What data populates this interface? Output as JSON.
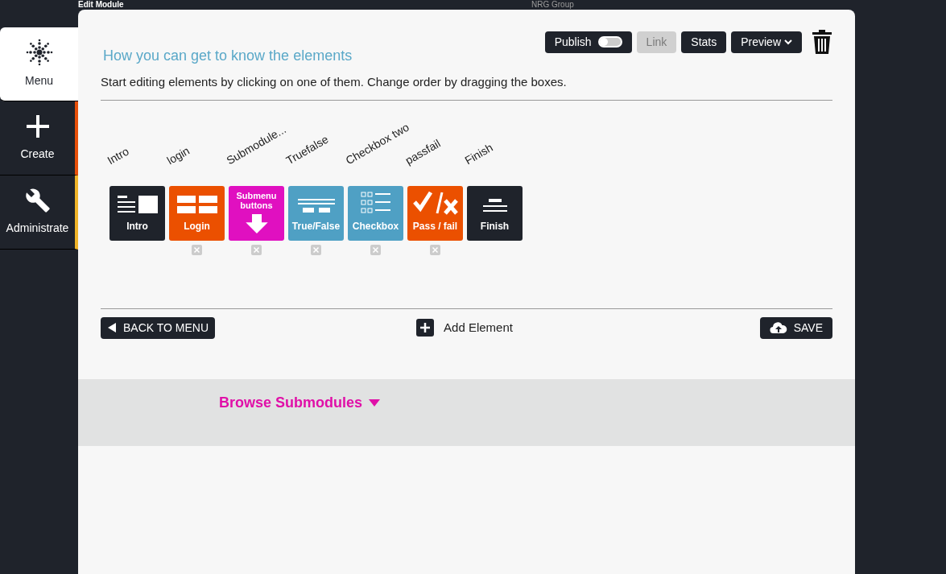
{
  "header": {
    "title": "Edit Module",
    "group": "NRG Group"
  },
  "sidebar": {
    "items": [
      {
        "label": "Menu",
        "kind": "menu",
        "selected": true,
        "color": "#ffffff"
      },
      {
        "label": "Create",
        "kind": "create",
        "selected": false,
        "color": "#e8500a"
      },
      {
        "label": "Administrate",
        "kind": "admin",
        "selected": false,
        "color": "#f0b428"
      }
    ]
  },
  "toolbar": {
    "publish": {
      "label": "Publish",
      "on": false
    },
    "link": {
      "label": "Link",
      "disabled": true
    },
    "stats": "Stats",
    "preview": "Preview"
  },
  "heading": "How you can get to know the elements",
  "instructions": "Start editing elements by clicking on one of them. Change order by dragging the boxes.",
  "elements": [
    {
      "name": "Intro",
      "title": "Intro",
      "kind": "intro",
      "color": "#1f232b",
      "removable": false
    },
    {
      "name": "login",
      "title": "Login",
      "kind": "login",
      "color": "#eb5000",
      "removable": true
    },
    {
      "name": "Submodule...",
      "title": "Submenu buttons",
      "kind": "submenu",
      "color": "#e010c0",
      "removable": true
    },
    {
      "name": "Truefalse",
      "title": "True/False",
      "kind": "truefalse",
      "color": "#4fa0c4",
      "removable": true
    },
    {
      "name": "Checkbox two",
      "title": "Checkbox",
      "kind": "checkbox",
      "color": "#4fa0c4",
      "removable": true
    },
    {
      "name": "passfail",
      "title": "Pass / fail",
      "kind": "passfail",
      "color": "#eb5000",
      "removable": true
    },
    {
      "name": "Finish",
      "title": "Finish",
      "kind": "finish",
      "color": "#1f232b",
      "removable": false
    }
  ],
  "actions": {
    "back": "BACK TO MENU",
    "add": "Add Element",
    "save": "SAVE"
  },
  "browse": "Browse Submodules"
}
